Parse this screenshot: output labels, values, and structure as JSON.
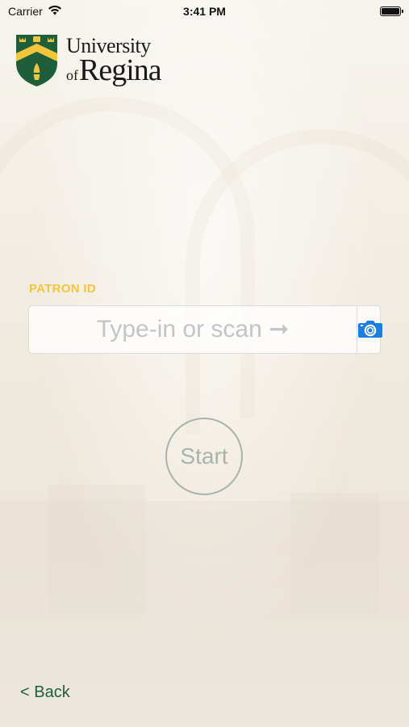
{
  "status_bar": {
    "carrier": "Carrier",
    "time": "3:41 PM",
    "wifi_icon": "wifi-icon",
    "battery_icon": "battery-icon"
  },
  "logo": {
    "line1": "University",
    "of": "of",
    "line2": "Regina",
    "shield_icon": "university-crest-icon",
    "colors": {
      "green": "#1f5e3a",
      "gold": "#f2c53d"
    }
  },
  "patron": {
    "label": "PATRON ID",
    "value": "",
    "placeholder": "Type-in or scan ➞",
    "scan_icon": "camera-icon"
  },
  "start_label": "Start",
  "back_label": "< Back",
  "colors": {
    "accent_gold": "#f2c53d",
    "camera_blue": "#1a7fe0",
    "back_green": "#1f5e3a"
  }
}
